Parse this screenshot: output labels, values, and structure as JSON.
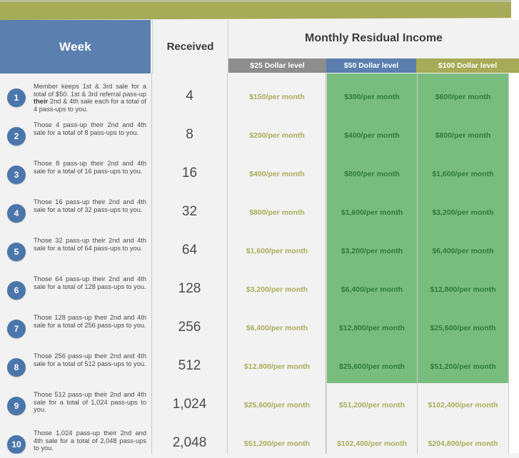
{
  "header": {
    "week_label": "Week",
    "received_label": "Received",
    "monthly_label": "Monthly Residual Income",
    "levels": [
      {
        "label": "$25 Dollar level",
        "color": "#8d8d8d"
      },
      {
        "label": "$50 Dollar level",
        "color": "#5b7faf"
      },
      {
        "label": "$100 Dollar level",
        "color": "#a5ab57"
      }
    ]
  },
  "colors": {
    "olive": "#a5ab57",
    "blue": "#5b7faf",
    "badge_blue": "#4a76ab",
    "green_highlight": "#79bd7e",
    "gold_text": "#a8ae5a",
    "green_text": "#2f7a37",
    "page_bg": "#f2f2f2"
  },
  "rows": [
    {
      "week": "1",
      "desc_pre": "Member keeps 1st & 3rd sale for a total of $50. 1st & 3rd referral pass-up ",
      "desc_bold": "their",
      "desc_post": " 2nd & 4th sale each for a total of 4 pass-ups to you.",
      "received": "4",
      "level25": "$150/per month",
      "level50": "$300/per month",
      "level100": "$600/per month",
      "highlight": true
    },
    {
      "week": "2",
      "desc_pre": "Those 4 pass-up their 2nd and 4th sale for a total of 8 pass-ups to you.",
      "desc_bold": "",
      "desc_post": "",
      "received": "8",
      "level25": "$200/per month",
      "level50": "$400/per month",
      "level100": "$800/per month",
      "highlight": true
    },
    {
      "week": "3",
      "desc_pre": "Those 8 pass-up their 2nd and 4th sale for a total of 16 pass-ups to you.",
      "desc_bold": "",
      "desc_post": "",
      "received": "16",
      "level25": "$400/per month",
      "level50": "$800/per month",
      "level100": "$1,600/per month",
      "highlight": true
    },
    {
      "week": "4",
      "desc_pre": "Those 16 pass-up their 2nd and 4th sale for a total of 32 pass-ups to you.",
      "desc_bold": "",
      "desc_post": "",
      "received": "32",
      "level25": "$800/per month",
      "level50": "$1,600/per month",
      "level100": "$3,200/per month",
      "highlight": true
    },
    {
      "week": "5",
      "desc_pre": "Those 32 pass-up their 2nd and 4th sale for a total of 64 pass-ups to you.",
      "desc_bold": "",
      "desc_post": "",
      "received": "64",
      "level25": "$1,600/per month",
      "level50": "$3,200/per month",
      "level100": "$6,400/per month",
      "highlight": true
    },
    {
      "week": "6",
      "desc_pre": "Those 64 pass-up their 2nd and 4th sale for a total of 128 pass-ups to you.",
      "desc_bold": "",
      "desc_post": "",
      "received": "128",
      "level25": "$3,200/per month",
      "level50": "$6,400/per month",
      "level100": "$12,800/per month",
      "highlight": true
    },
    {
      "week": "7",
      "desc_pre": "Those 128 pass-up their 2nd and 4th sale for a total of 256 pass-ups to you.",
      "desc_bold": "",
      "desc_post": "",
      "received": "256",
      "level25": "$6,400/per month",
      "level50": "$12,800/per month",
      "level100": "$25,600/per month",
      "highlight": true
    },
    {
      "week": "8",
      "desc_pre": "Those 256 pass-up their 2nd and 4th sale for a total of 512 pass-ups to you.",
      "desc_bold": "",
      "desc_post": "",
      "received": "512",
      "level25": "$12,800/per month",
      "level50": "$25,600/per month",
      "level100": "$51,200/per month",
      "highlight": true
    },
    {
      "week": "9",
      "desc_pre": "Those 512 pass-up their 2nd and 4th sale for a total of 1,024 pass-ups to you.",
      "desc_bold": "",
      "desc_post": "",
      "received": "1,024",
      "level25": "$25,600/per month",
      "level50": "$51,200/per month",
      "level100": "$102,400/per month",
      "highlight": false
    },
    {
      "week": "10",
      "desc_pre": "Those 1,024 pass-up their 2nd and 4th sale for a total of 2,048 pass-ups to you.",
      "desc_bold": "",
      "desc_post": "",
      "received": "2,048",
      "level25": "$51,200/per month",
      "level50": "$102,400/per month",
      "level100": "$204,800/per month",
      "highlight": false
    }
  ]
}
